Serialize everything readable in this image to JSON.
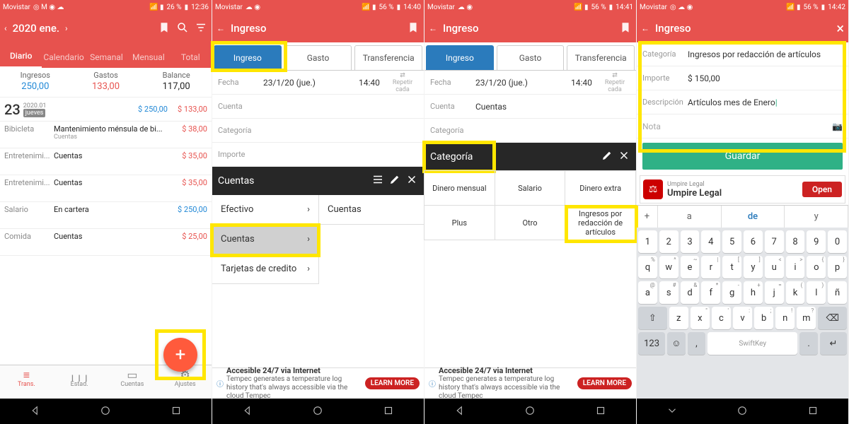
{
  "status": {
    "carrier": "Movistar",
    "time1": "12:36",
    "batt1": "26 %",
    "time2": "14:40",
    "batt2": "56 %",
    "time3": "14:41",
    "batt3": "56 %",
    "time4": "14:42",
    "batt4": "56 %"
  },
  "panel1": {
    "title": "2020 ene.",
    "tabs": [
      "Diario",
      "Calendario",
      "Semanal",
      "Mensual",
      "Total"
    ],
    "summary": {
      "income_label": "Ingresos",
      "income": "250,00",
      "expense_label": "Gastos",
      "expense": "133,00",
      "balance_label": "Balance",
      "balance": "117,00"
    },
    "day": {
      "num": "23",
      "ym": "2020.01",
      "dow": "jueves",
      "income": "$ 250,00",
      "expense": "$ 133,00"
    },
    "rows": [
      {
        "cat": "Bibicleta",
        "title": "Mantenimiento ménsula de bi...",
        "sub": "Cuentas",
        "amt": "$ 38,00",
        "cls": "red"
      },
      {
        "cat": "Entretenimi...",
        "title": "Cuentas",
        "sub": "",
        "amt": "$ 35,00",
        "cls": "red"
      },
      {
        "cat": "Entretenimi...",
        "title": "Cuentas",
        "sub": "",
        "amt": "$ 35,00",
        "cls": "red"
      },
      {
        "cat": "Salario",
        "title": "En cartera",
        "sub": "",
        "amt": "$ 250,00",
        "cls": "blue"
      },
      {
        "cat": "Comida",
        "title": "Cuentas",
        "sub": "",
        "amt": "$ 25,00",
        "cls": "red"
      }
    ],
    "bottomnav": [
      {
        "icon": "☰",
        "label": "Trans."
      },
      {
        "icon": "⬪⬪",
        "label": "Estad."
      },
      {
        "icon": "▭",
        "label": "Cuentas"
      },
      {
        "icon": "⚙",
        "label": "Ajustes"
      }
    ]
  },
  "panel2": {
    "title": "Ingreso",
    "tabs": [
      "Ingreso",
      "Gasto",
      "Transferencia"
    ],
    "form": {
      "fecha_label": "Fecha",
      "fecha": "23/1/20 (jue.)",
      "hora": "14:40",
      "repeat": "Repetir cada",
      "cuenta_label": "Cuenta",
      "categoria_label": "Categoría",
      "importe_label": "Importe"
    },
    "accounts_header": "Cuentas",
    "accounts": [
      "Efectivo",
      "Cuentas",
      "Tarjetas de credito"
    ],
    "column2": "Cuentas",
    "ad": {
      "title": "Accesible 24/7 via Internet",
      "text": "Tempec generates a temperature log history that's always accessible via the cloud Tempec",
      "btn": "LEARN MORE"
    }
  },
  "panel3": {
    "title": "Ingreso",
    "form": {
      "cuenta_val": "Cuentas"
    },
    "categories_header": "Categoría",
    "categories": [
      "Dinero mensual",
      "Salario",
      "Dinero extra",
      "Plus",
      "Otro",
      "Ingresos por redacción de artículos"
    ]
  },
  "panel4": {
    "title": "Ingreso",
    "form": {
      "categoria_label": "Categoría",
      "categoria": "Ingresos por redacción de artículos",
      "importe_label": "Importe",
      "importe": "$ 150,00",
      "desc_label": "Descripción",
      "desc": "Artículos mes de Enero",
      "nota_label": "Nota"
    },
    "save": "Guardar",
    "ump": {
      "title": "Umpire Legal",
      "sub": "Umpire Legal",
      "btn": "Open"
    },
    "sugg": {
      "a": "a",
      "b": "de",
      "c": "y",
      "plus": "+"
    },
    "keyboard_space": "SwiftKey"
  }
}
